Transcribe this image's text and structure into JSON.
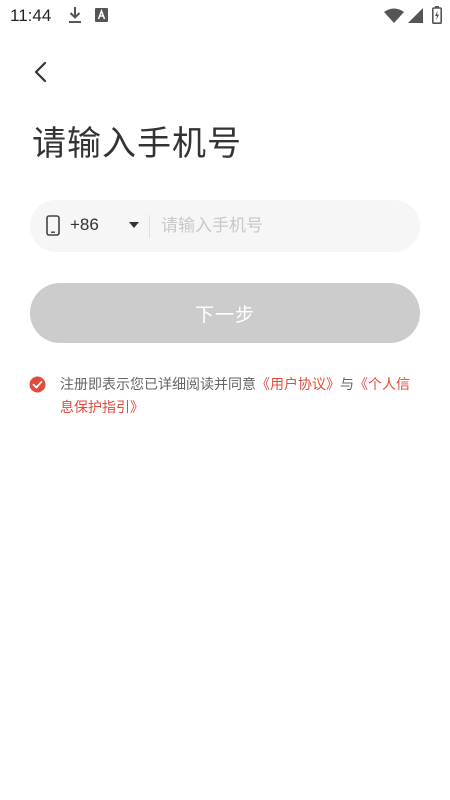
{
  "status_bar": {
    "time": "11:44",
    "icons": [
      "download-icon",
      "font-a-icon",
      "wifi-icon",
      "signal-icon",
      "battery-icon"
    ]
  },
  "header": {
    "back_icon": "chevron-left-icon",
    "title": "请输入手机号"
  },
  "phone": {
    "icon": "phone-icon",
    "country_code": "+86",
    "placeholder": "请输入手机号",
    "value": ""
  },
  "next_button": {
    "label": "下一步"
  },
  "agreement": {
    "checked": true,
    "text": "注册即表示您已详细阅读并同意",
    "user_agreement": "《用户协议》",
    "and": "与",
    "privacy": "《个人信息保护指引》"
  },
  "colors": {
    "accent": "#e14b3c",
    "button_disabled": "#cccccc",
    "input_bg": "#f6f6f6"
  }
}
